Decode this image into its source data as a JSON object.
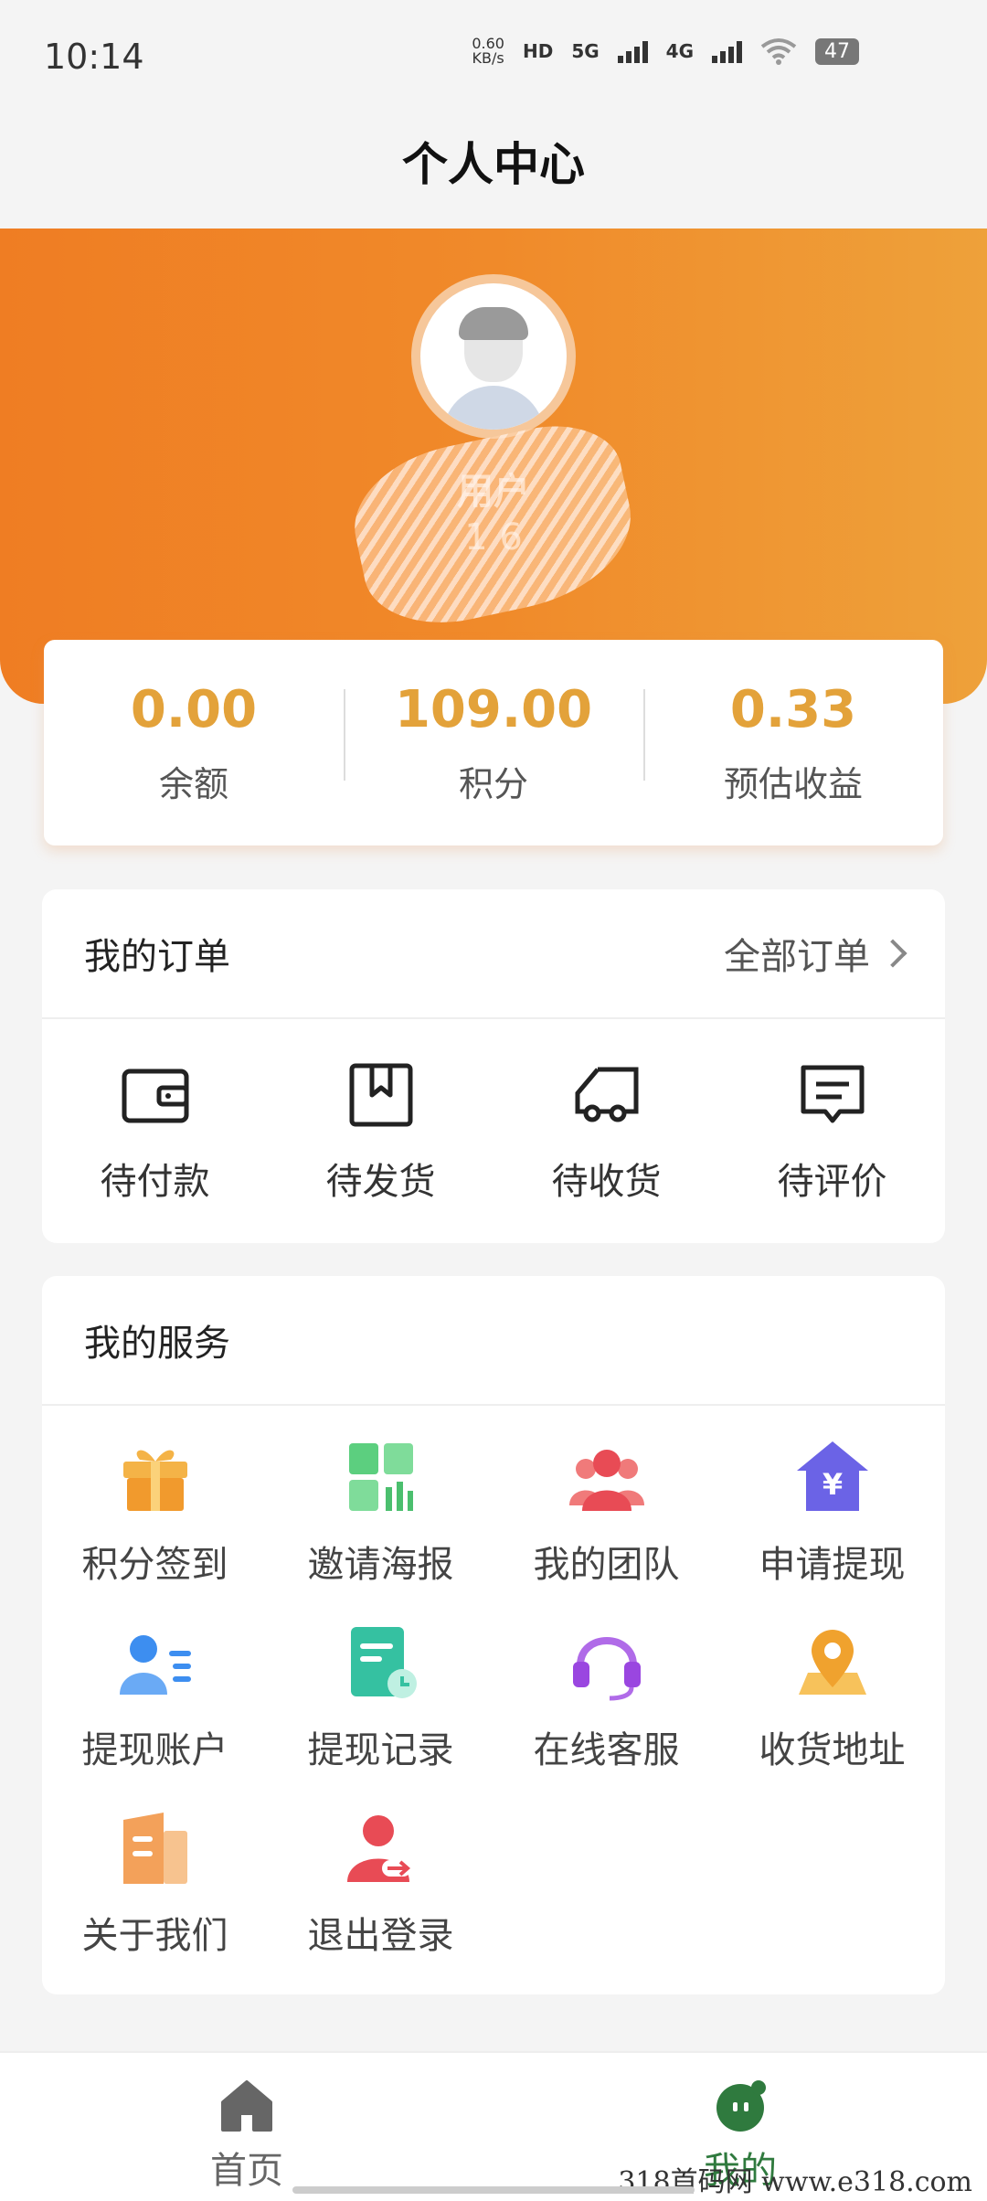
{
  "status_bar": {
    "time": "10:14",
    "speed_value": "0.60",
    "speed_unit": "KB/s",
    "hd": "HD",
    "net1": "5G",
    "net2": "4G",
    "battery": "47",
    "icons": [
      "signal-icon",
      "signal-icon",
      "wifi-icon",
      "battery-icon"
    ]
  },
  "header": {
    "title": "个人中心"
  },
  "profile": {
    "avatar_icon": "default-avatar-icon",
    "name": "用户",
    "phone": "1         6"
  },
  "stats": [
    {
      "value": "0.00",
      "label": "余额"
    },
    {
      "value": "109.00",
      "label": "积分"
    },
    {
      "value": "0.33",
      "label": "预估收益"
    }
  ],
  "orders": {
    "title": "我的订单",
    "all_link": "全部订单",
    "items": [
      {
        "label": "待付款",
        "icon": "wallet-icon"
      },
      {
        "label": "待发货",
        "icon": "package-icon"
      },
      {
        "label": "待收货",
        "icon": "truck-icon"
      },
      {
        "label": "待评价",
        "icon": "comment-icon"
      }
    ]
  },
  "services": {
    "title": "我的服务",
    "items": [
      {
        "label": "积分签到",
        "icon": "gift-icon"
      },
      {
        "label": "邀请海报",
        "icon": "poster-grid-icon"
      },
      {
        "label": "我的团队",
        "icon": "team-icon"
      },
      {
        "label": "申请提现",
        "icon": "yuan-house-icon"
      },
      {
        "label": "提现账户",
        "icon": "account-icon"
      },
      {
        "label": "提现记录",
        "icon": "record-icon"
      },
      {
        "label": "在线客服",
        "icon": "headset-icon"
      },
      {
        "label": "收货地址",
        "icon": "location-icon"
      },
      {
        "label": "关于我们",
        "icon": "building-icon"
      },
      {
        "label": "退出登录",
        "icon": "logout-icon"
      }
    ]
  },
  "tabs": [
    {
      "label": "首页",
      "icon": "home-icon"
    },
    {
      "label": "我的",
      "icon": "profile-face-icon"
    }
  ],
  "watermark": "318首码网  www.e318.com",
  "colors": {
    "accent_orange": "#ef7d23",
    "stat_gold": "#e3a23a",
    "active_tab_green": "#2f7a3e"
  }
}
